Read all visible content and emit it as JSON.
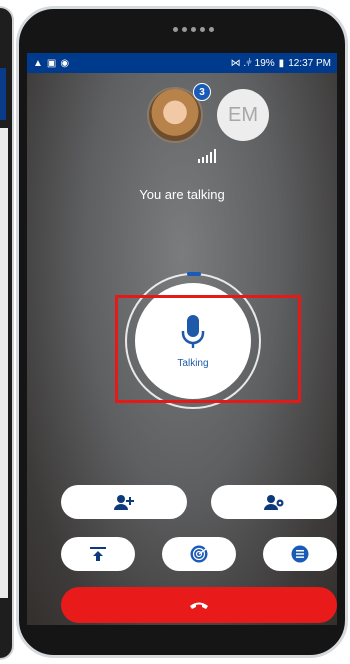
{
  "status_bar": {
    "left_icons": [
      "alert-icon",
      "image-icon",
      "chat-icon"
    ],
    "signal_text": "⋈ .⫩ 19%",
    "time": "12:37 PM"
  },
  "participants": {
    "badge_count": "3",
    "initials": "EM"
  },
  "call": {
    "status": "You are talking",
    "mic_label": "Talking"
  },
  "actions": {
    "row1": [
      "add-participant-icon",
      "contacts-settings-icon"
    ],
    "row2": [
      "upload-icon",
      "radar-icon",
      "list-icon"
    ],
    "end_call": "end-call-icon"
  },
  "colors": {
    "status_bar": "#003a8c",
    "accent_blue": "#1e5aa8",
    "end_call_red": "#e81a1a",
    "highlight_red": "#e61919"
  }
}
